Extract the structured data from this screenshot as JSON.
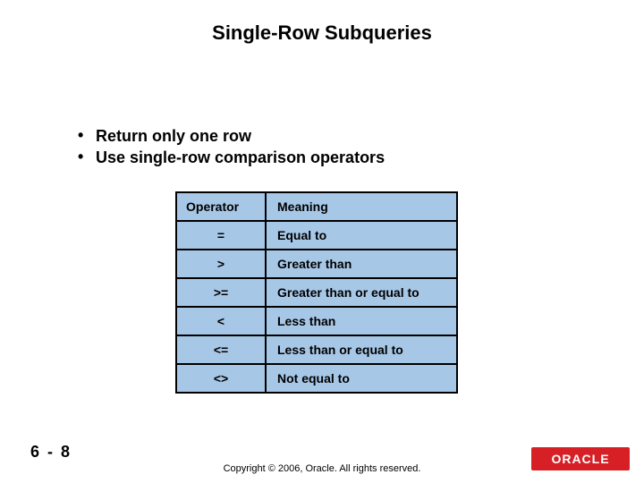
{
  "title": "Single-Row Subqueries",
  "bullets": [
    "Return only one row",
    "Use single-row comparison operators"
  ],
  "table": {
    "headers": {
      "operator": "Operator",
      "meaning": "Meaning"
    },
    "rows": [
      {
        "operator": "=",
        "meaning": "Equal to"
      },
      {
        "operator": ">",
        "meaning": "Greater than"
      },
      {
        "operator": ">=",
        "meaning": "Greater than or equal to"
      },
      {
        "operator": "<",
        "meaning": "Less than"
      },
      {
        "operator": "<=",
        "meaning": "Less than or equal to"
      },
      {
        "operator": "<>",
        "meaning": "Not equal to"
      }
    ]
  },
  "page_number": "6 - 8",
  "copyright": "Copyright © 2006, Oracle. All rights reserved.",
  "logo_text": "ORACLE"
}
